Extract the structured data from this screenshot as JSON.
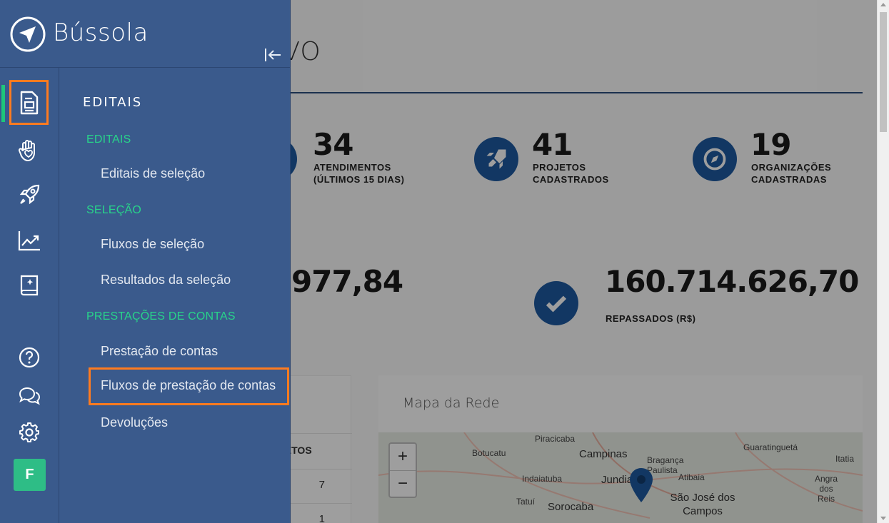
{
  "brand": {
    "name": "Bússola"
  },
  "dashboard": {
    "title_partial": "ATIVO",
    "stats": [
      {
        "value": "34",
        "label": "ATENDIMENTOS (ÚLTIMOS 15 DIAS)"
      },
      {
        "value": "41",
        "label": "PROJETOS CADASTRADOS"
      },
      {
        "value": "19",
        "label": "ORGANIZAÇÕES CADASTRADAS"
      }
    ],
    "money_partial": "977,84",
    "repassados": {
      "value": "160.714.626,70",
      "label": "REPASSADOS (R$)"
    },
    "table": {
      "header_partial": "JETOS",
      "rows": [
        "7",
        "1"
      ]
    },
    "map": {
      "title": "Mapa da Rede",
      "zoom_in": "+",
      "zoom_out": "−",
      "cities": [
        "Piracicaba",
        "Botucatu",
        "Campinas",
        "Bragança Paulista",
        "Guaratinguetá",
        "Itatia",
        "Indaiatuba",
        "Jundiaí",
        "Atibaia",
        "Angra dos Reis",
        "Tatuí",
        "Sorocaba",
        "São José dos Campos"
      ]
    }
  },
  "sidebar": {
    "rail": [
      {
        "name": "editais",
        "icon": "document-icon",
        "active": true
      },
      {
        "name": "atendimentos",
        "icon": "hand-heart-icon"
      },
      {
        "name": "projetos",
        "icon": "rocket-icon"
      },
      {
        "name": "indicadores",
        "icon": "trending-chart-icon"
      },
      {
        "name": "biblioteca",
        "icon": "book-icon"
      },
      {
        "name": "ajuda",
        "icon": "help-circle-icon"
      },
      {
        "name": "mensagens",
        "icon": "chat-icon"
      },
      {
        "name": "configuracoes",
        "icon": "gear-icon"
      }
    ],
    "avatar": "F",
    "section_title": "EDITAIS",
    "groups": [
      {
        "label": "EDITAIS",
        "items": [
          "Editais de seleção"
        ]
      },
      {
        "label": "SELEÇÃO",
        "items": [
          "Fluxos de seleção",
          "Resultados da seleção"
        ]
      },
      {
        "label": "PRESTAÇÕES DE CONTAS",
        "items": [
          "Prestação de contas",
          "Fluxos de prestação de contas",
          "Devoluções"
        ]
      }
    ]
  },
  "colors": {
    "sidebar": "#3a5a8c",
    "accent_green": "#28d48a",
    "highlight": "#ff7b1f",
    "icon_blue": "#1e5aa0"
  }
}
